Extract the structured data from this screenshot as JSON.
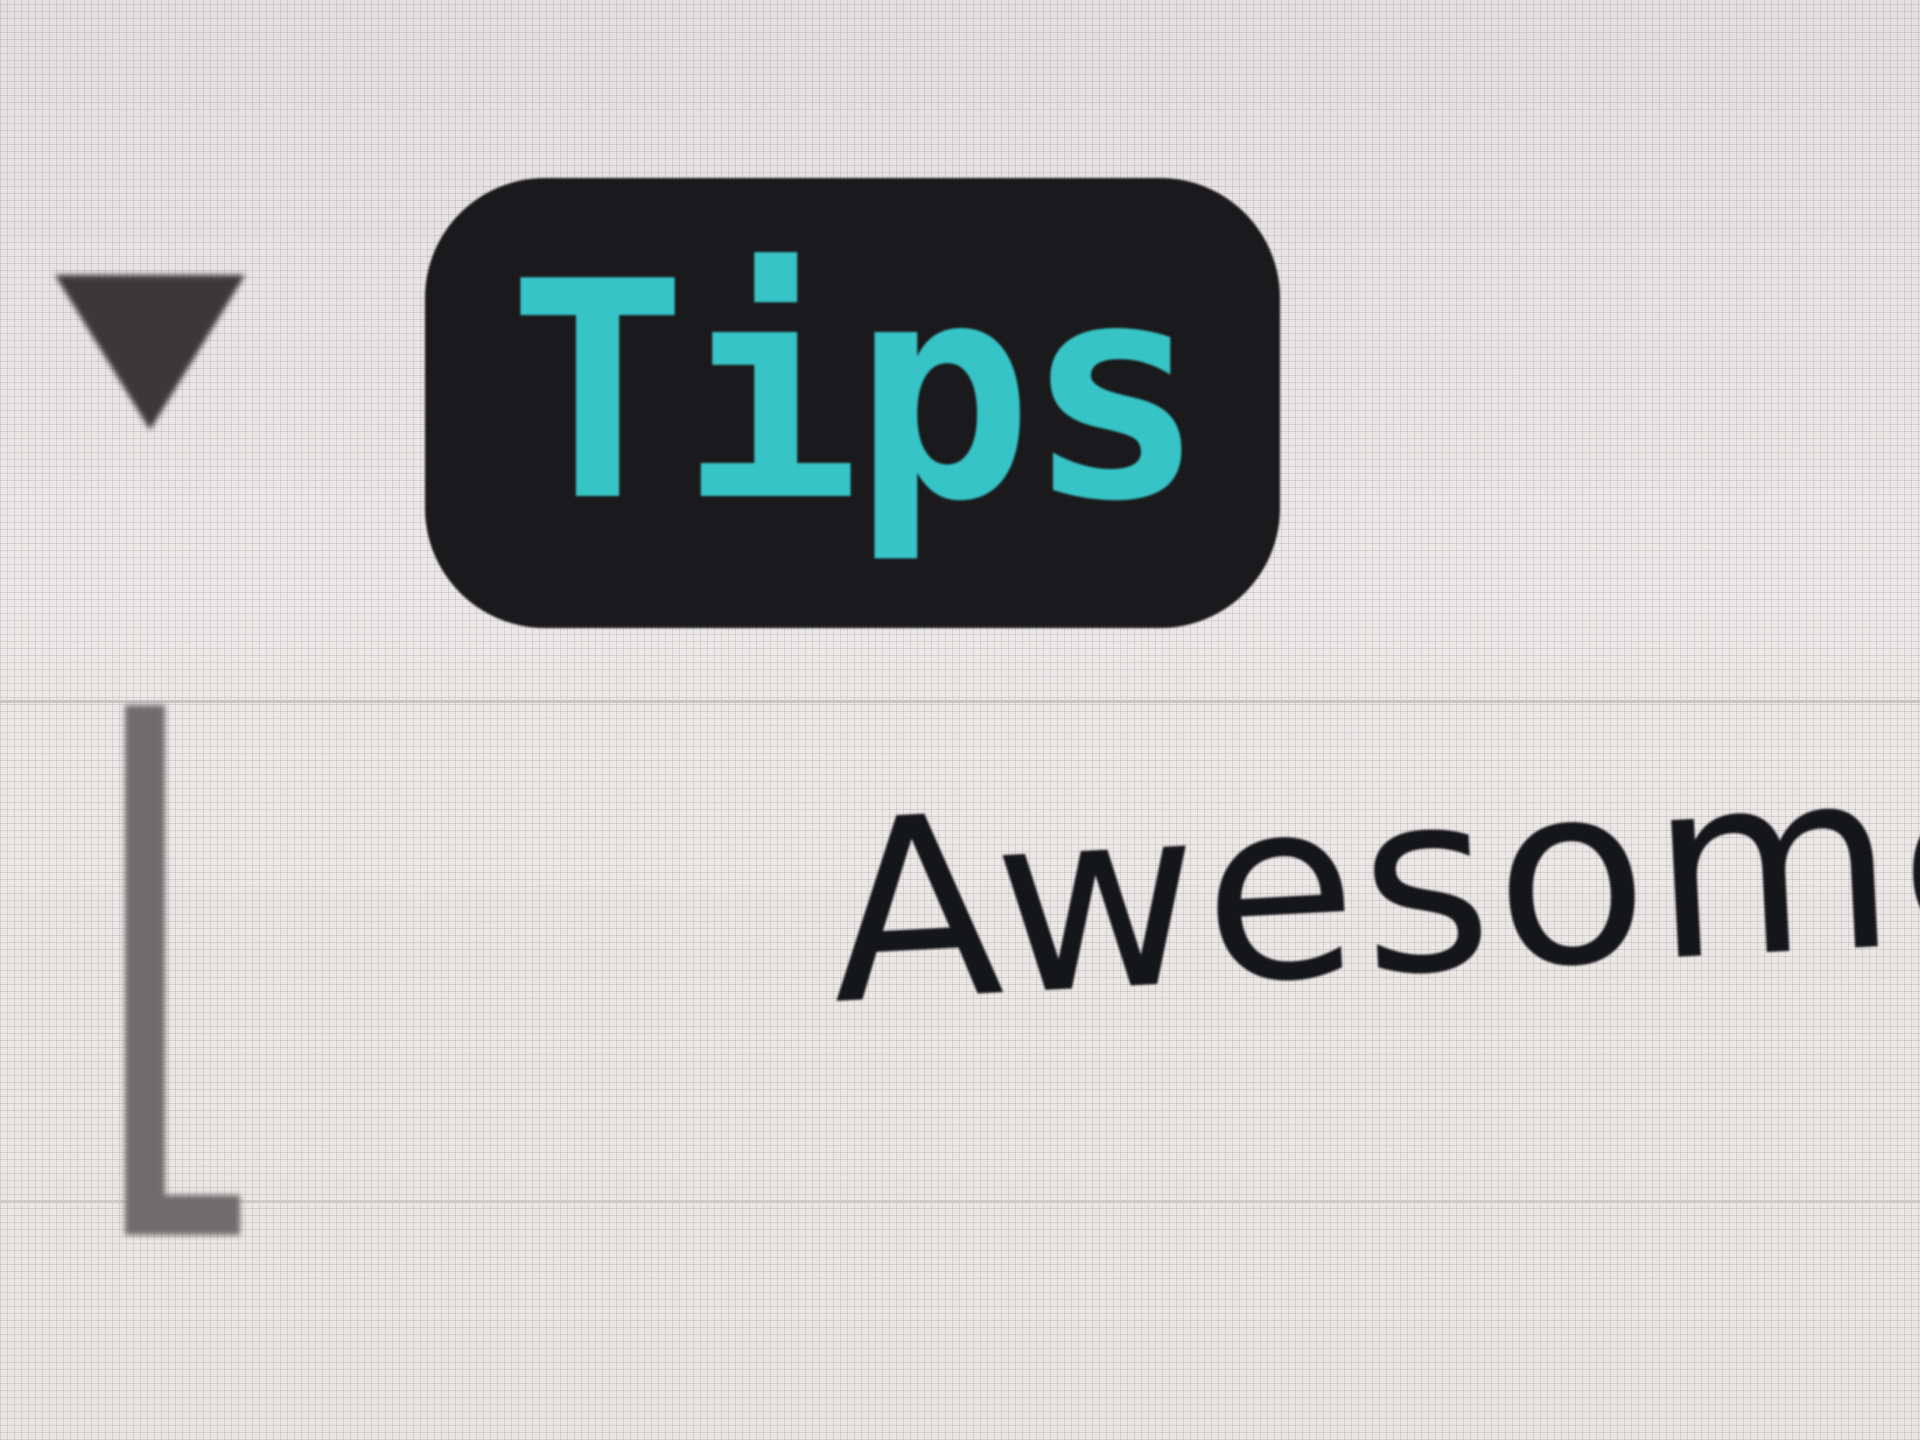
{
  "badge": {
    "label": "Tips",
    "text_color": "#36c4c6",
    "background_color": "#1a1a1c"
  },
  "row": {
    "label": "Awesome"
  },
  "icons": {
    "disclosure": "disclosure-triangle-down-icon",
    "tree_connector": "tree-bracket-icon"
  },
  "colors": {
    "screen_background": "#e8e4e4",
    "text": "#15161a"
  }
}
